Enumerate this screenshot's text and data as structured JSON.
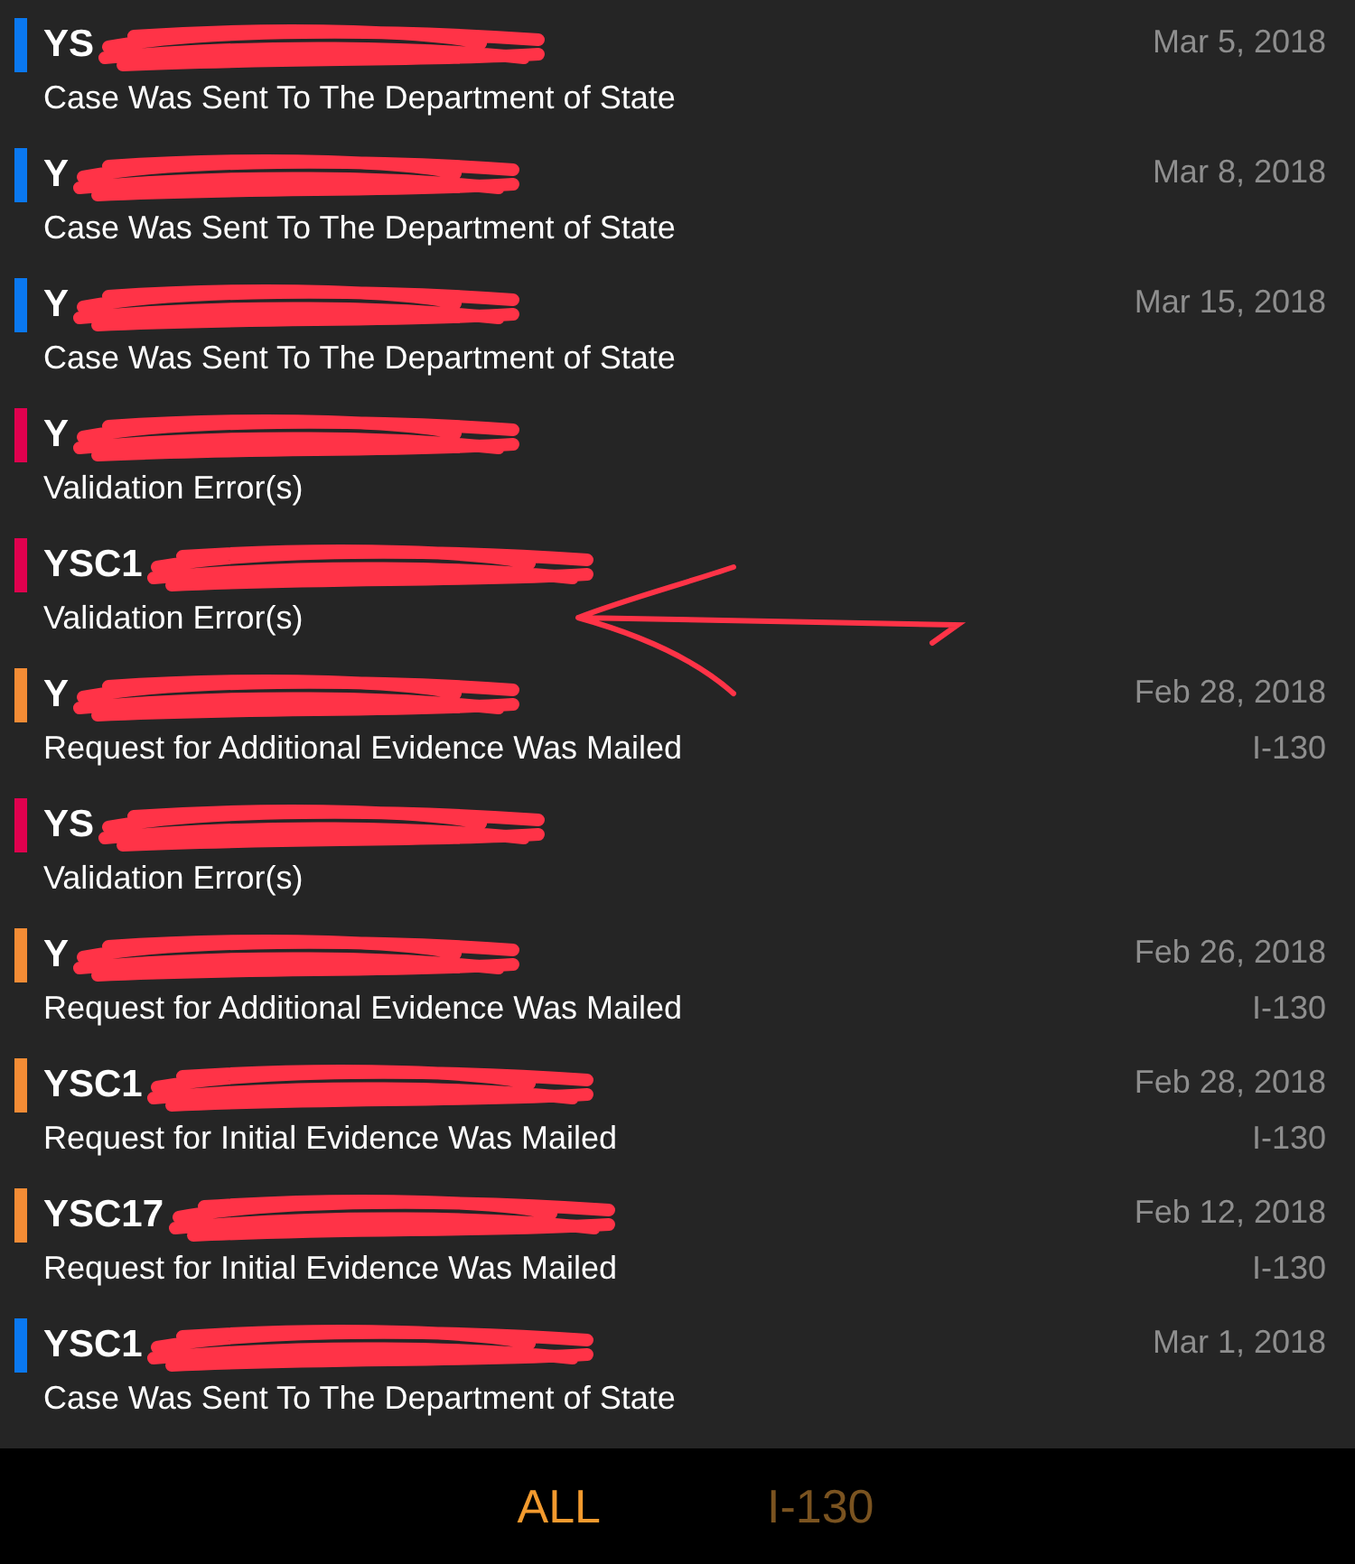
{
  "cases": [
    {
      "number": "YS",
      "status": "Case Was Sent To The Department of State",
      "date": "Mar 5, 2018",
      "color": "#0a78f0"
    },
    {
      "number": "Y",
      "status": "Case Was Sent To The Department of State",
      "date": "Mar 8, 2018",
      "color": "#0a78f0"
    },
    {
      "number": "Y",
      "status": "Case Was Sent To The Department of State",
      "date": "Mar 15, 2018",
      "color": "#0a78f0"
    },
    {
      "number": "Y",
      "status": "Validation Error(s)",
      "color": "#e0004e"
    },
    {
      "number": "YSC1",
      "status": "Validation Error(s)",
      "color": "#e0004e"
    },
    {
      "number": "Y",
      "status": "Request for Additional Evidence Was Mailed",
      "date": "Feb 28, 2018",
      "form": "I-130",
      "color": "#f48c35"
    },
    {
      "number": "YS",
      "status": "Validation Error(s)",
      "color": "#e0004e"
    },
    {
      "number": "Y",
      "status": "Request for Additional Evidence Was Mailed",
      "date": "Feb 26, 2018",
      "form": "I-130",
      "color": "#f48c35"
    },
    {
      "number": "YSC1",
      "status": "Request for Initial Evidence Was Mailed",
      "date": "Feb 28, 2018",
      "form": "I-130",
      "color": "#f48c35"
    },
    {
      "number": "YSC17",
      "status": "Request for Initial Evidence Was Mailed",
      "date": "Feb 12, 2018",
      "form": "I-130",
      "color": "#f48c35"
    },
    {
      "number": "YSC1",
      "status": "Case Was Sent To The Department of State",
      "date": "Mar 1, 2018",
      "color": "#0a78f0"
    }
  ],
  "tabs": [
    {
      "label": "ALL",
      "selected": true
    },
    {
      "label": "I-130",
      "selected": false
    }
  ]
}
